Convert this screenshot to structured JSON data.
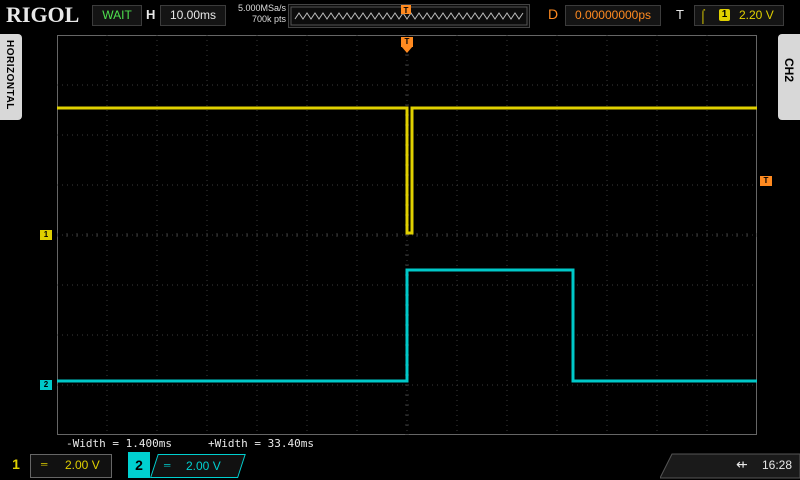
{
  "brand": {
    "logo": "RIGOL"
  },
  "status": {
    "run_state": "WAIT"
  },
  "horizontal": {
    "label": "H",
    "timebase": "10.00ms",
    "sample_rate": "5.000MSa/s",
    "memory_depth": "700k pts"
  },
  "delay": {
    "label": "D",
    "value": "0.00000000ps"
  },
  "trigger": {
    "label": "T",
    "edge_icon": "rising-edge-icon",
    "source": "1",
    "level": "2.20 V"
  },
  "side_tabs": {
    "left": "HORIZONTAL",
    "right": "CH2"
  },
  "measurements": {
    "neg_width": "-Width = 1.400ms",
    "pos_width": "+Width = 33.40ms"
  },
  "channels": [
    {
      "number": "1",
      "coupling": "DC",
      "scale": "2.00 V",
      "color": "#e0d000"
    },
    {
      "number": "2",
      "coupling": "DC",
      "scale": "2.00 V",
      "color": "#00c8c8"
    }
  ],
  "markers": {
    "ch1": "1",
    "ch2": "2",
    "trigger_level": "T",
    "trigger_pos": "T"
  },
  "system": {
    "usb_icon": "usb-icon",
    "time": "16:28"
  },
  "grid": {
    "h_divisions": 14,
    "v_divisions": 8,
    "color": "#3a3a3a"
  },
  "waveforms": {
    "ch1": {
      "description": "high, drops to ~1 div below midline for 1.4ms at trigger, returns high"
    },
    "ch2": {
      "description": "low at -2 div, pulses high for 33.4ms after trigger, then low"
    }
  }
}
